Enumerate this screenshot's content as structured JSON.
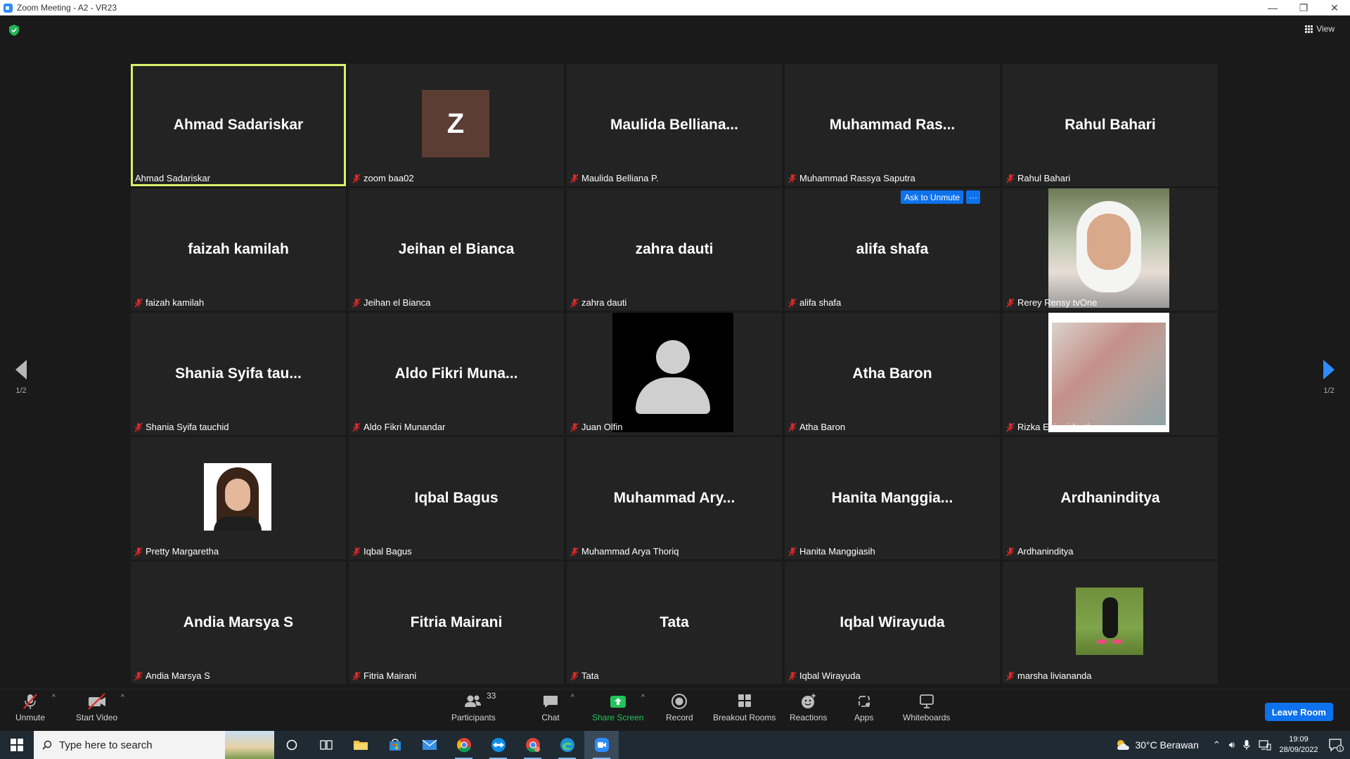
{
  "window": {
    "title": "Zoom Meeting - A2 - VR23",
    "minimize": "—",
    "restore": "❐",
    "close": "✕"
  },
  "top": {
    "view_label": "View"
  },
  "tiles": [
    {
      "big": "Ahmad Sadariskar",
      "label": "Ahmad Sadariskar",
      "muted": false,
      "active": true
    },
    {
      "big": "",
      "label": "zoom baa02",
      "muted": true,
      "avatar_letter": "Z"
    },
    {
      "big": "Maulida  Belliana...",
      "label": "Maulida Belliana P.",
      "muted": true
    },
    {
      "big": "Muhammad  Ras...",
      "label": "Muhammad Rassya Saputra",
      "muted": true
    },
    {
      "big": "Rahul Bahari",
      "label": "Rahul Bahari",
      "muted": true
    },
    {
      "big": "faizah kamilah",
      "label": "faizah kamilah",
      "muted": true
    },
    {
      "big": "Jeihan el Bianca",
      "label": "Jeihan el Bianca",
      "muted": true
    },
    {
      "big": "zahra dauti",
      "label": "zahra dauti",
      "muted": true
    },
    {
      "big": "alifa shafa",
      "label": "alifa shafa",
      "muted": true,
      "ask_to_unmute": "Ask to Unmute",
      "more": "···"
    },
    {
      "big": "",
      "label": "Rerey Rensy tvOne",
      "muted": true,
      "photo": "rerey"
    },
    {
      "big": "Shania  Syifa  tau...",
      "label": "Shania Syifa tauchid",
      "muted": true
    },
    {
      "big": "Aldo  Fikri  Muna...",
      "label": "Aldo Fikri Munandar",
      "muted": true
    },
    {
      "big": "",
      "label": "Juan Olfin",
      "muted": true,
      "photo": "juan"
    },
    {
      "big": "Atha Baron",
      "label": "Atha Baron",
      "muted": true
    },
    {
      "big": "",
      "label": "Rizka Egiawidanti",
      "muted": true,
      "photo": "rizka"
    },
    {
      "big": "",
      "label": "Pretty Margaretha",
      "muted": true,
      "photo": "pretty"
    },
    {
      "big": "Iqbal Bagus",
      "label": "Iqbal Bagus",
      "muted": true
    },
    {
      "big": "Muhammad  Ary...",
      "label": "Muhammad Arya Thoriq",
      "muted": true
    },
    {
      "big": "Hanita  Manggia...",
      "label": "Hanita Manggiasih",
      "muted": true
    },
    {
      "big": "Ardhaninditya",
      "label": "Ardhaninditya",
      "muted": true
    },
    {
      "big": "Andia Marsya S",
      "label": "Andia Marsya S",
      "muted": true
    },
    {
      "big": "Fitria Mairani",
      "label": "Fitria Mairani",
      "muted": true
    },
    {
      "big": "Tata",
      "label": "Tata",
      "muted": true
    },
    {
      "big": "Iqbal Wirayuda",
      "label": "Iqbal Wirayuda",
      "muted": true
    },
    {
      "big": "",
      "label": "marsha liviananda",
      "muted": true,
      "photo": "marsha"
    }
  ],
  "pager": {
    "left": "1/2",
    "right": "1/2"
  },
  "toolbar": {
    "unmute": "Unmute",
    "start_video": "Start Video",
    "participants": "Participants",
    "participant_count": "33",
    "chat": "Chat",
    "share_screen": "Share Screen",
    "record": "Record",
    "breakout_rooms": "Breakout Rooms",
    "reactions": "Reactions",
    "apps": "Apps",
    "whiteboards": "Whiteboards",
    "leave": "Leave Room",
    "caret": "^"
  },
  "taskbar": {
    "search_placeholder": "Type here to search",
    "weather": "30°C  Berawan",
    "time": "19:09",
    "date": "28/09/2022",
    "notification_count": "1"
  },
  "colors": {
    "active_speaker": "#d8ef6b",
    "accent_blue": "#0e72ed",
    "share_green": "#22c35a",
    "muted_red": "#e02828"
  }
}
